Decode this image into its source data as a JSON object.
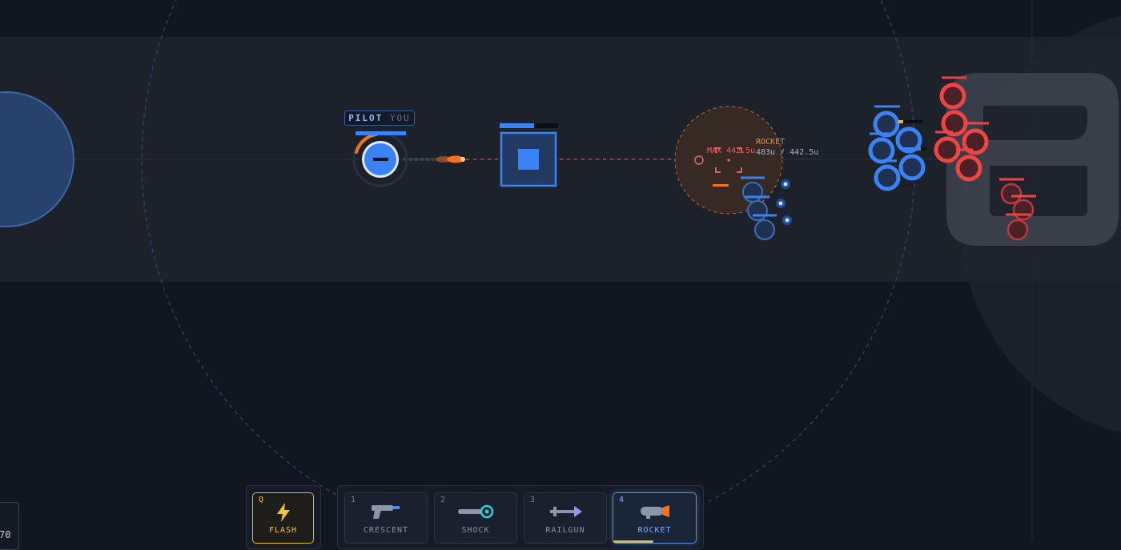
{
  "player": {
    "tag_prefix": "PILOT",
    "tag_suffix": "YOU"
  },
  "target": {
    "weapon_label": "ROCKET",
    "distance_text": "483u / 442.5u",
    "max_range_text": "MAX 442.5u"
  },
  "hotbar": {
    "ability": {
      "key": "Q",
      "label": "FLASH",
      "icon": "lightning-icon",
      "color": "#f2c53d"
    },
    "weapons": [
      {
        "key": "1",
        "label": "CRESCENT",
        "icon": "pistol-icon",
        "active": false
      },
      {
        "key": "2",
        "label": "SHOCK",
        "icon": "shock-emitter-icon",
        "active": false
      },
      {
        "key": "3",
        "label": "RAILGUN",
        "icon": "railgun-icon",
        "active": false
      },
      {
        "key": "4",
        "label": "ROCKET",
        "icon": "rocket-launcher-icon",
        "active": true
      }
    ]
  },
  "corner_readout": "70",
  "colors": {
    "team_blue": "#3b82f6",
    "team_red": "#ef4444",
    "rocket": "#f97316",
    "ability": "#f2c53d"
  }
}
